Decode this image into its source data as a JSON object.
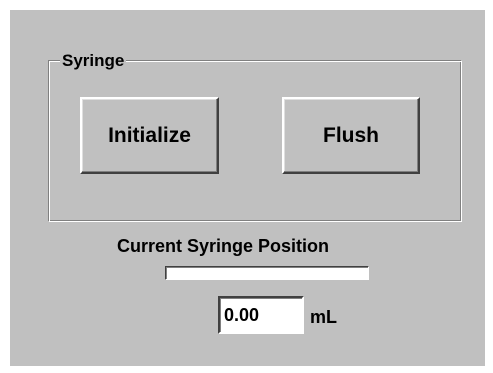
{
  "syringe_group": {
    "label": "Syringe",
    "initialize_label": "Initialize",
    "flush_label": "Flush"
  },
  "position": {
    "label": "Current Syringe Position",
    "progress_fraction": 0,
    "value": "0.00",
    "unit": "mL"
  },
  "colors": {
    "panel": "#c0c0c0",
    "progress_fill": "#000080"
  }
}
